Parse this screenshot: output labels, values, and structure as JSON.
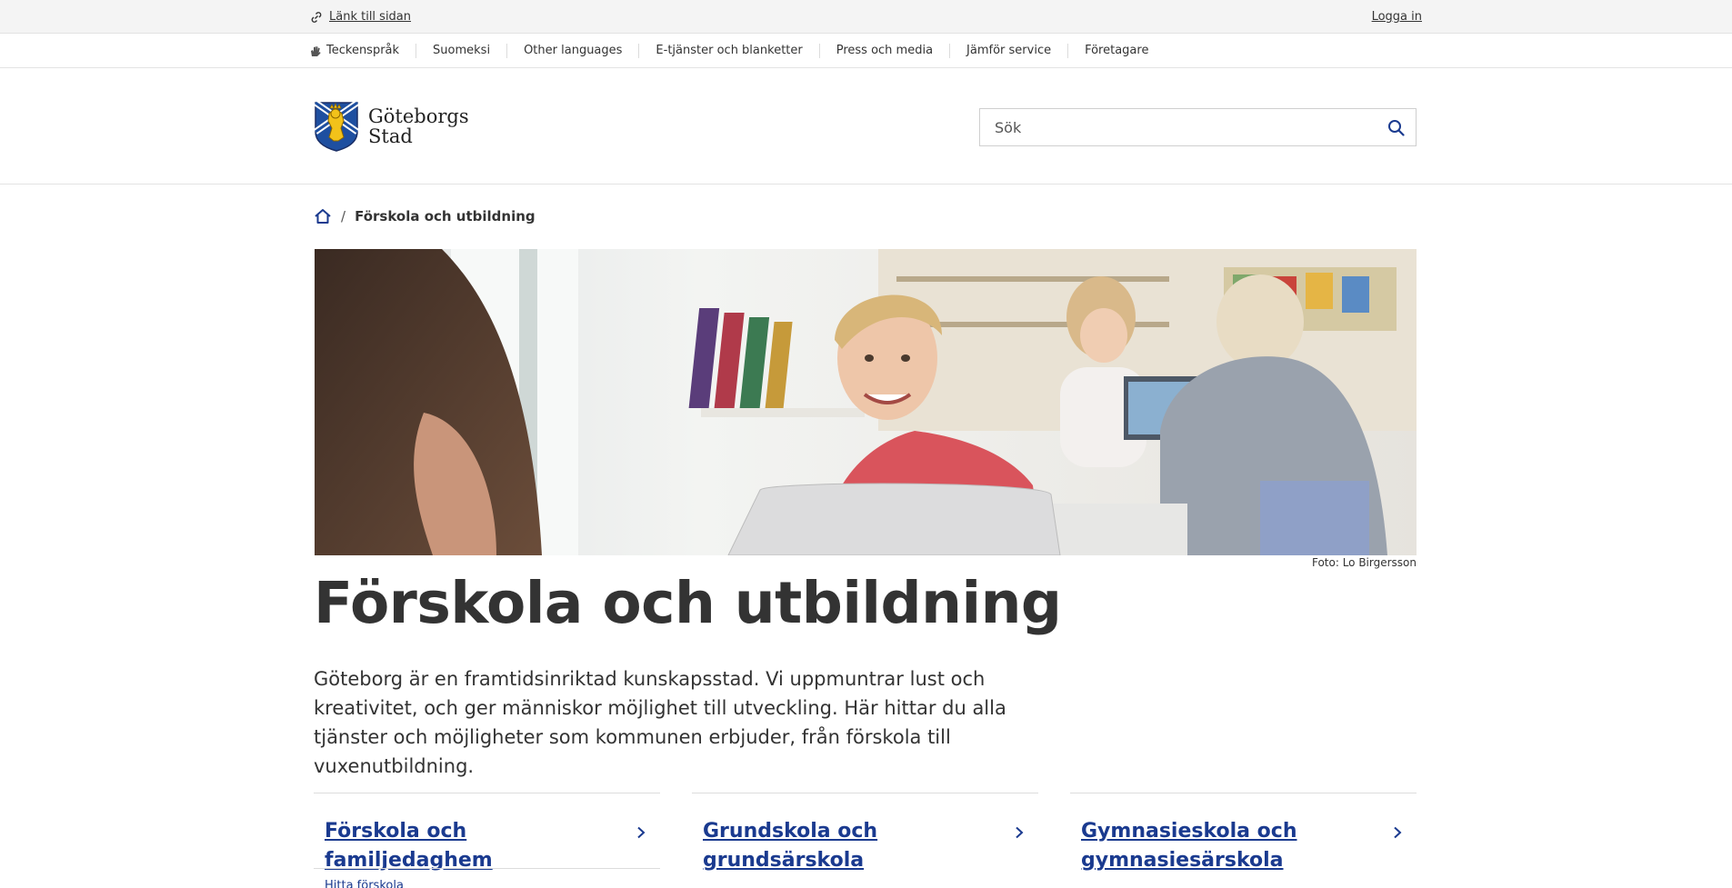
{
  "utility": {
    "link_label": "Länk till sidan",
    "login_label": "Logga in"
  },
  "secondary_nav": {
    "items": [
      {
        "label": "Teckenspråk",
        "icon": "hand-sign-icon"
      },
      {
        "label": "Suomeksi"
      },
      {
        "label": "Other languages"
      },
      {
        "label": "E-tjänster och blanketter"
      },
      {
        "label": "Press och media"
      },
      {
        "label": "Jämför service"
      },
      {
        "label": "Företagare"
      }
    ]
  },
  "header": {
    "logo_line1": "Göteborgs",
    "logo_line2": "Stad",
    "search_placeholder": "Sök"
  },
  "breadcrumb": {
    "separator": "/",
    "current": "Förskola och utbildning"
  },
  "hero": {
    "photo_credit": "Foto: Lo Birgersson"
  },
  "main": {
    "title": "Förskola och utbildning",
    "intro": "Göteborg är en framtidsinriktad kunskapsstad. Vi uppmuntrar lust och kreativitet, och ger människor möjlighet till utveckling. Här hittar du alla tjänster och möjligheter som kommunen erbjuder, från förskola till vuxenutbildning."
  },
  "cards": [
    {
      "title": "Förskola och familjedaghem",
      "sub": "Hitta förskola"
    },
    {
      "title": "Grundskola och grundsärskola"
    },
    {
      "title": "Gymnasieskola och gymnasiesärskola"
    }
  ],
  "colors": {
    "link_blue": "#1a3a8f",
    "text": "#333333",
    "utility_bg": "#f4f4f4"
  }
}
